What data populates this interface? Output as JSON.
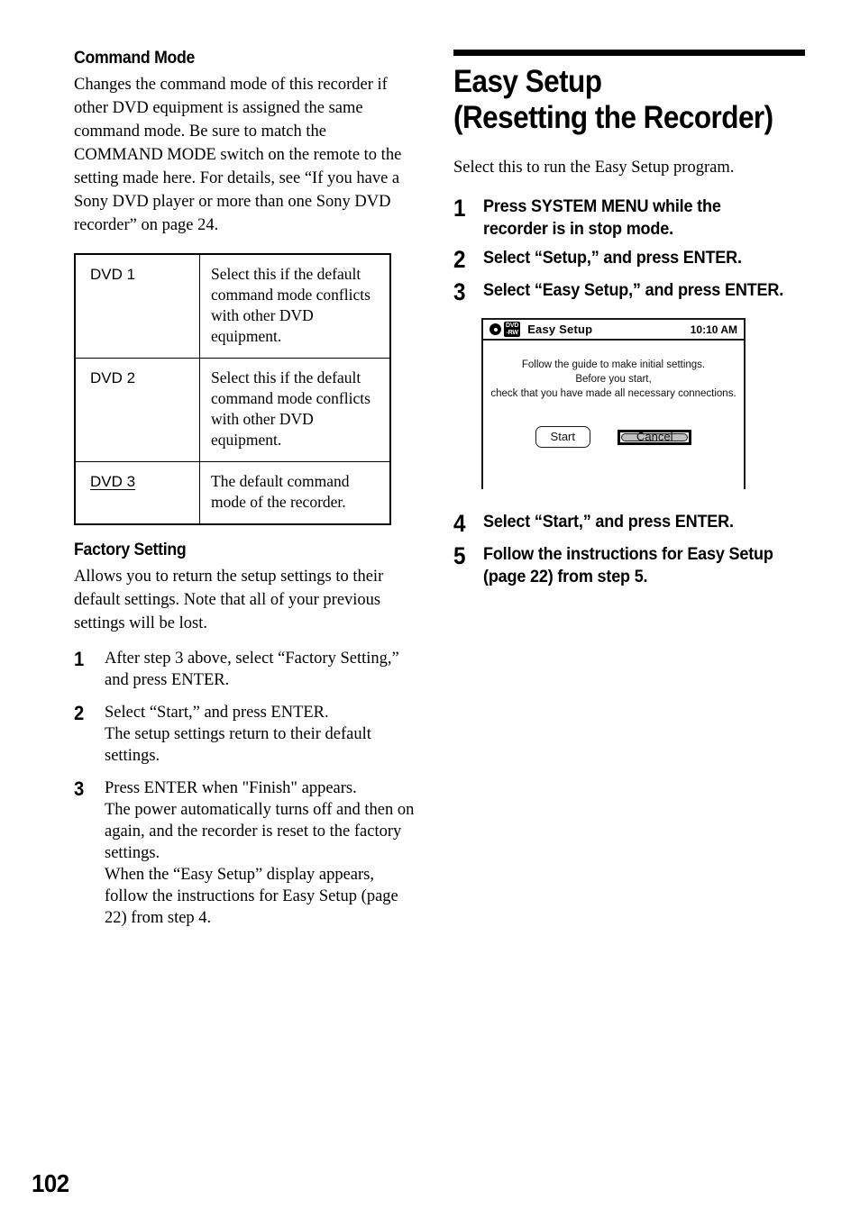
{
  "page": {
    "number": "102"
  },
  "left_column": {
    "command_mode": {
      "heading": "Command Mode",
      "body": "Changes the command mode of this recorder if other DVD equipment is assigned the same command mode. Be sure to match the COMMAND MODE switch on the remote to the setting made here. For details, see “If you have a Sony DVD player or more than one Sony DVD recorder” on page 24.",
      "table": {
        "rows": [
          {
            "setting": "DVD 1",
            "underlined": false,
            "description": "Select this if the default command mode conflicts with other DVD equipment."
          },
          {
            "setting": "DVD 2",
            "underlined": false,
            "description": "Select this if the default command mode conflicts with other DVD equipment."
          },
          {
            "setting": "DVD 3",
            "underlined": true,
            "description": "The default command mode of the recorder."
          }
        ]
      }
    },
    "factory_setting": {
      "heading": "Factory Setting",
      "body": "Allows you to return the setup settings to their default settings. Note that all of your previous settings will be lost.",
      "steps": [
        {
          "number": "1",
          "text": "After step 3 above, select “Factory Setting,” and press ENTER."
        },
        {
          "number": "2",
          "text": "Select “Start,” and press ENTER.\nThe setup settings return to their default settings."
        },
        {
          "number": "3",
          "text": "Press ENTER when \"Finish\" appears.\nThe power automatically turns off and then on again, and the recorder is reset to the factory settings.\nWhen the “Easy Setup” display appears, follow the instructions for Easy Setup (page 22) from step 4."
        }
      ]
    }
  },
  "right_column": {
    "heading_line1": "Easy Setup",
    "heading_line2": "(Resetting the Recorder)",
    "intro": "Select this to run the Easy Setup program.",
    "steps_before": [
      {
        "number": "1",
        "text": "Press SYSTEM MENU while the recorder is in stop mode."
      },
      {
        "number": "2",
        "text": "Select “Setup,” and press ENTER."
      },
      {
        "number": "3",
        "text": "Select “Easy Setup,” and press ENTER."
      }
    ],
    "osd_screen": {
      "disc_icon": "disc-icon",
      "disc_badge_line1": "DVD",
      "disc_badge_line2": "-RW",
      "title": "Easy Setup",
      "clock": "10:10 AM",
      "message_lines": [
        "Follow the guide to make initial settings.",
        "Before you start,",
        "check that you have made all necessary connections."
      ],
      "buttons": [
        {
          "label": "Start",
          "selected": false
        },
        {
          "label": "Cancel",
          "selected": true
        }
      ]
    },
    "steps_after": [
      {
        "number": "4",
        "text": "Select “Start,” and press ENTER."
      },
      {
        "number": "5",
        "text": "Follow the instructions for Easy Setup (page 22) from step 5."
      }
    ]
  }
}
